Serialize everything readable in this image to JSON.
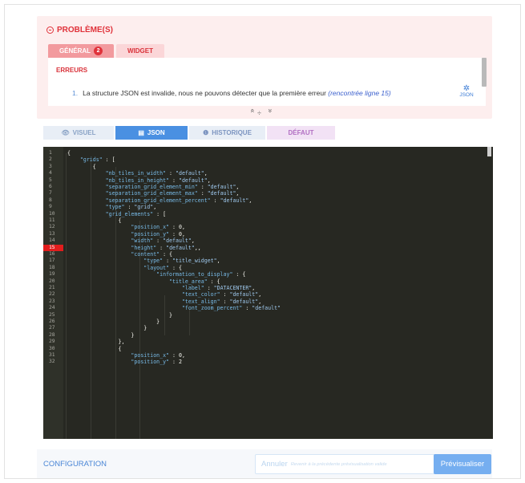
{
  "problems": {
    "title": "PROBLÈME(S)",
    "tabs": [
      {
        "label": "GÉNÉRAL",
        "badge": "2"
      },
      {
        "label": "WIDGET"
      }
    ],
    "errors_title": "ERREURS",
    "error": {
      "number": "1.",
      "message": "La structure JSON est invalide, nous ne pouvons détecter que la première erreur ",
      "link": "(rencontrée ligne 15)"
    },
    "json_link_label": "JSON",
    "json_link_icon": "gear-icon"
  },
  "panel_controls": {
    "up": "«",
    "resize": "÷",
    "down": "»"
  },
  "editor_tabs": [
    {
      "label": "VISUEL",
      "icon": "eye-icon"
    },
    {
      "label": "JSON",
      "icon": "code-icon"
    },
    {
      "label": "HISTORIQUE",
      "icon": "info-icon"
    },
    {
      "label": "DÉFAUT"
    }
  ],
  "code": {
    "error_line": 15,
    "lines": [
      [
        "{"
      ],
      [
        "    ",
        "\"grids\"",
        " : ["
      ],
      [
        "        {"
      ],
      [
        "            ",
        "\"nb_tiles_in_width\"",
        " : ",
        "\"default\"",
        ","
      ],
      [
        "            ",
        "\"nb_tiles_in_height\"",
        " : ",
        "\"default\"",
        ","
      ],
      [
        "            ",
        "\"separation_grid_element_min\"",
        " : ",
        "\"default\"",
        ","
      ],
      [
        "            ",
        "\"separation_grid_element_max\"",
        " : ",
        "\"default\"",
        ","
      ],
      [
        "            ",
        "\"separation_grid_element_percent\"",
        " : ",
        "\"default\"",
        ","
      ],
      [
        "            ",
        "\"type\"",
        " : ",
        "\"grid\"",
        ","
      ],
      [
        "            ",
        "\"grid_elements\"",
        " : ["
      ],
      [
        "                {"
      ],
      [
        "                    ",
        "\"position_x\"",
        " : ",
        "0",
        ","
      ],
      [
        "                    ",
        "\"position_y\"",
        " : ",
        "0",
        ","
      ],
      [
        "                    ",
        "\"width\"",
        " : ",
        "\"default\"",
        ","
      ],
      [
        "                    ",
        "\"height\"",
        " : ",
        "\"default\"",
        ",,"
      ],
      [
        "                    ",
        "\"content\"",
        " : {"
      ],
      [
        "                        ",
        "\"type\"",
        " : ",
        "\"title_widget\"",
        ","
      ],
      [
        "                        ",
        "\"layout\"",
        " : {"
      ],
      [
        "                            ",
        "\"information_to_display\"",
        " : {"
      ],
      [
        "                                ",
        "\"title_area\"",
        " : {"
      ],
      [
        "                                    ",
        "\"label\"",
        " : ",
        "\"DATACENTER\"",
        ","
      ],
      [
        "                                    ",
        "\"text_color\"",
        " : ",
        "\"default\"",
        ","
      ],
      [
        "                                    ",
        "\"text_align\"",
        " : ",
        "\"default\"",
        ","
      ],
      [
        "                                    ",
        "\"font_zoom_percent\"",
        " : ",
        "\"default\""
      ],
      [
        "                                }"
      ],
      [
        "                            }"
      ],
      [
        "                        }"
      ],
      [
        "                    }"
      ],
      [
        "                },"
      ],
      [
        "                {"
      ],
      [
        "                    ",
        "\"position_x\"",
        " : ",
        "0",
        ","
      ],
      [
        "                    ",
        "\"position_y\"",
        " : ",
        "2"
      ]
    ]
  },
  "footer": {
    "configuration": "CONFIGURATION",
    "cancel_label": "Annuler",
    "cancel_hint": "Revenir à la précédente prévisualisation valide",
    "preview_label": "Prévisualiser"
  },
  "colors": {
    "error_red": "#e0323a",
    "accent_blue": "#4a90e2",
    "editor_bg": "#272822"
  }
}
